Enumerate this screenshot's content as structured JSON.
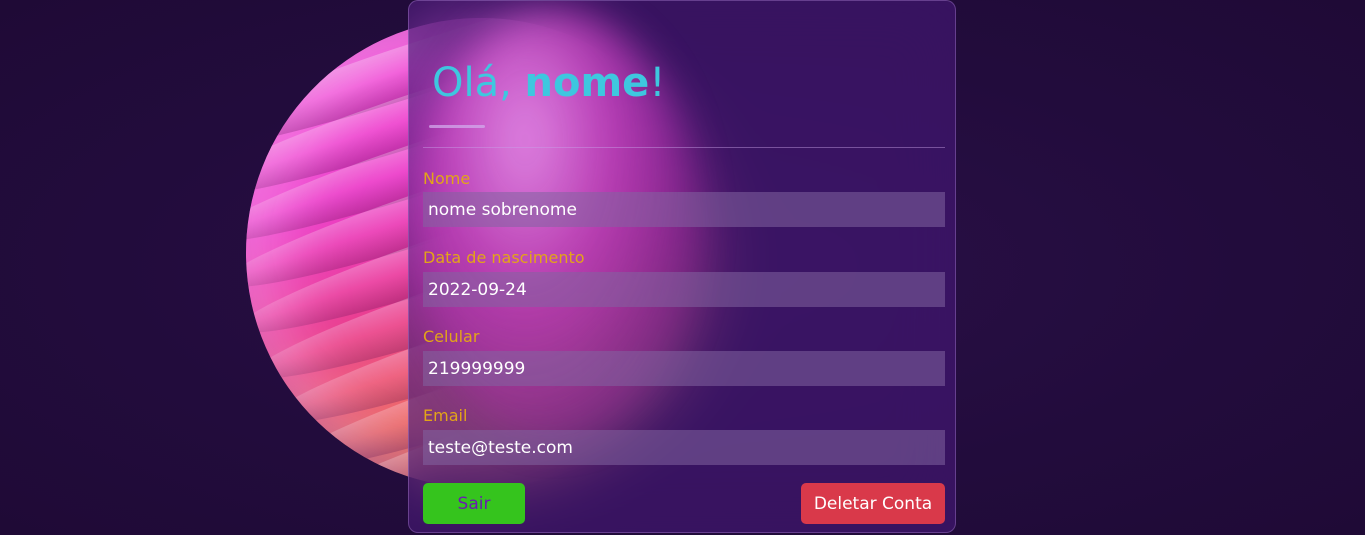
{
  "header": {
    "greeting": "Olá, ",
    "name": "nome",
    "exclamation": "!"
  },
  "form": {
    "nome": {
      "label": "Nome",
      "value": "nome sobrenome"
    },
    "nascimento": {
      "label": "Data de nascimento",
      "value": "2022-09-24"
    },
    "celular": {
      "label": "Celular",
      "value": "219999999"
    },
    "email": {
      "label": "Email",
      "value": "teste@teste.com"
    }
  },
  "actions": {
    "logout_label": "Sair",
    "delete_label": "Deletar Conta"
  },
  "colors": {
    "background": "#220c3c",
    "card": "#46187a",
    "title": "#3ec7df",
    "label": "#e3a418",
    "logout_button": "#35c41d",
    "logout_text": "#6a1bb0",
    "delete_button": "#d9394a"
  }
}
